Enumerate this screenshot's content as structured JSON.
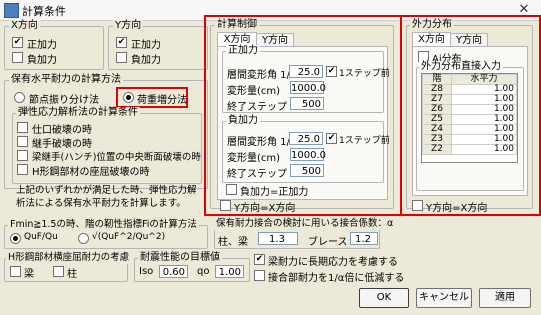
{
  "window": {
    "title": "計算条件",
    "close_glyph": "✕"
  },
  "x_dir": {
    "title": "X方向",
    "positive": "正加力",
    "negative": "負加力"
  },
  "y_dir": {
    "title": "Y方向",
    "positive": "正加力",
    "negative": "負加力"
  },
  "horizontal_capacity": {
    "title": "保有水平耐力の計算方法",
    "nodal": "節点振り分け法",
    "load_increment": "荷重増分法",
    "elastic_limit": {
      "title": "弾性応力解析法の計算条件",
      "items": [
        "仕口破壊の時",
        "継手破壊の時",
        "梁継手(ハンチ)位置の中央断面破壊の時",
        "H形鋼部材の座屈破壊の時"
      ],
      "note": "上記のいずれかが満足した時、弾性応力解析法による保有水平耐力を計算します。"
    }
  },
  "calc_control": {
    "title": "計算制御",
    "tabs": [
      "X方向",
      "Y方向"
    ],
    "positive": {
      "title": "正加力",
      "story_drift_label": "層間変形角  1/",
      "story_drift_value": "25.0",
      "first_step_label": "1ステップ前",
      "displacement_label": "変形量(cm)",
      "displacement_value": "1000.0",
      "end_step_label": "終了ステップ",
      "end_step_value": "500"
    },
    "negative": {
      "title": "負加力",
      "story_drift_label": "層間変形角  1/",
      "story_drift_value": "25.0",
      "first_step_label": "1ステップ前",
      "displacement_label": "変形量(cm)",
      "displacement_value": "1000.0",
      "end_step_label": "終了ステップ",
      "end_step_value": "500"
    },
    "neg_equals_pos": "負加力=正加力",
    "y_equals_x": "Y方向=X方向"
  },
  "ext_force": {
    "title": "外力分布",
    "tabs": [
      "X方向",
      "Y方向"
    ],
    "ai": "Ai分布",
    "direct_input": "外力分布直接入力",
    "col_floor": "階",
    "col_force": "水平力",
    "rows": [
      {
        "floor": "Z8",
        "value": "1.00"
      },
      {
        "floor": "Z7",
        "value": "1.00"
      },
      {
        "floor": "Z6",
        "value": "1.00"
      },
      {
        "floor": "Z5",
        "value": "1.00"
      },
      {
        "floor": "Z4",
        "value": "1.00"
      },
      {
        "floor": "Z3",
        "value": "1.00"
      },
      {
        "floor": "Z2",
        "value": "1.00"
      }
    ],
    "y_equals_x": "Y方向=X方向"
  },
  "fmin": {
    "title": "Fmin≧1.5の時、階の靭性指標Fiの計算方法",
    "opt1": "QuF/Qu",
    "opt2": "√(QuF^2/Qu^2)"
  },
  "joint_factor": {
    "title": "保有耐力接合の検討に用いる接合係数：α",
    "column_beam_label": "柱、梁",
    "column_beam_value": "1.3",
    "brace_label": "ブレース",
    "brace_value": "1.2"
  },
  "h_lateral": {
    "title": "H形鋼部材横座屈耐力の考慮",
    "beam": "梁",
    "column": "柱"
  },
  "seismic": {
    "title": "耐震性能の目標値",
    "iso_label": "Iso",
    "iso_value": "0.60",
    "qo_label": "qo",
    "qo_value": "1.00"
  },
  "options": {
    "long_term": "梁耐力に長期応力を考慮する",
    "joint_reduction": "接合部耐力を1/α倍に低減する"
  },
  "buttons": {
    "ok": "OK",
    "cancel": "キャンセル",
    "apply": "適用"
  },
  "check_glyph": "✔"
}
